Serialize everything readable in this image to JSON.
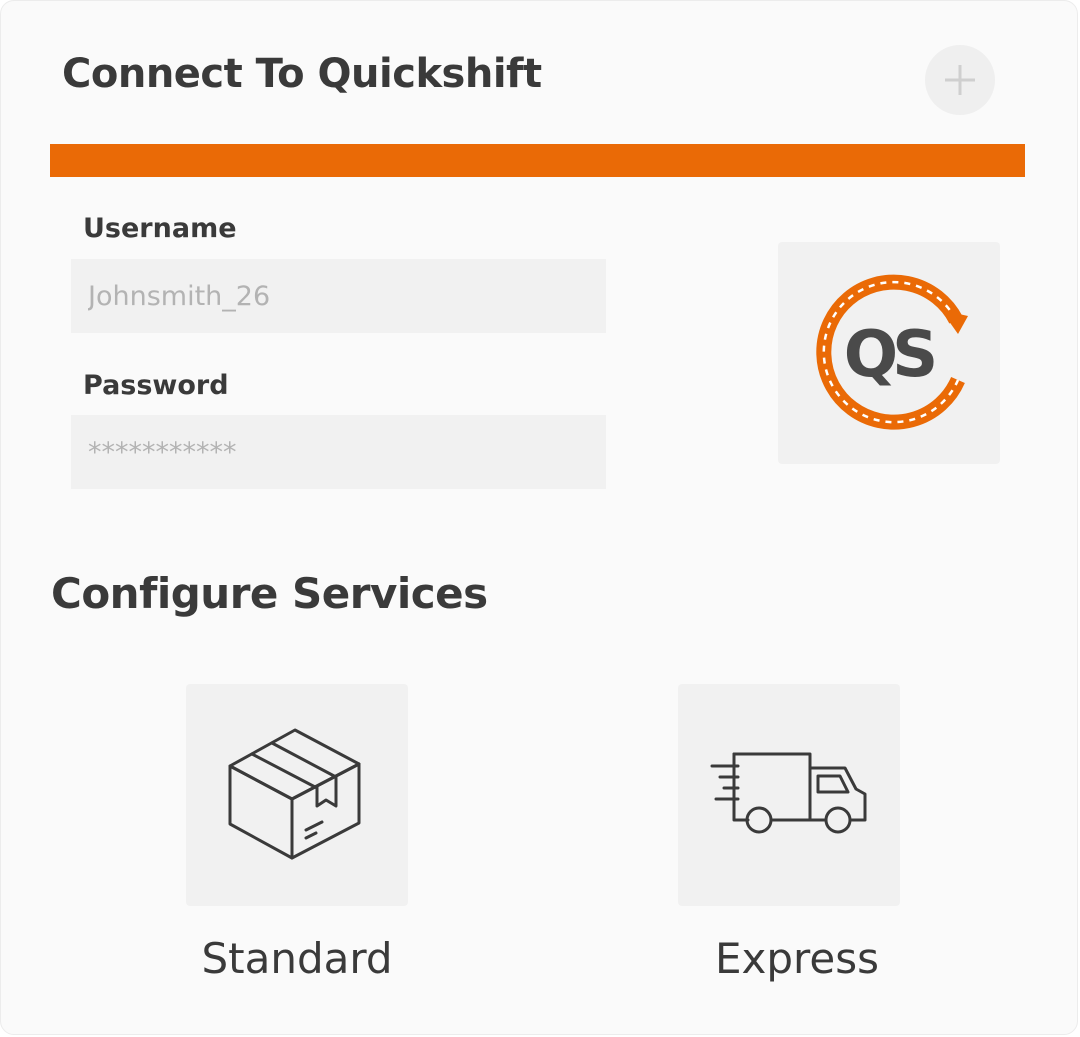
{
  "header": {
    "title": "Connect To Quickshift",
    "add_icon": "plus-icon"
  },
  "colors": {
    "accent": "#ea6a06",
    "text": "#3a3a3a",
    "field_bg": "#f1f1f1"
  },
  "form": {
    "username_label": "Username",
    "username_placeholder": "Johnsmith_26",
    "password_label": "Password",
    "password_placeholder": "***********"
  },
  "logo": {
    "text": "QS",
    "icon": "quickshift-logo"
  },
  "services": {
    "title": "Configure Services",
    "items": [
      {
        "label": "Standard",
        "icon": "package-box-icon"
      },
      {
        "label": "Express",
        "icon": "delivery-truck-icon"
      }
    ]
  }
}
